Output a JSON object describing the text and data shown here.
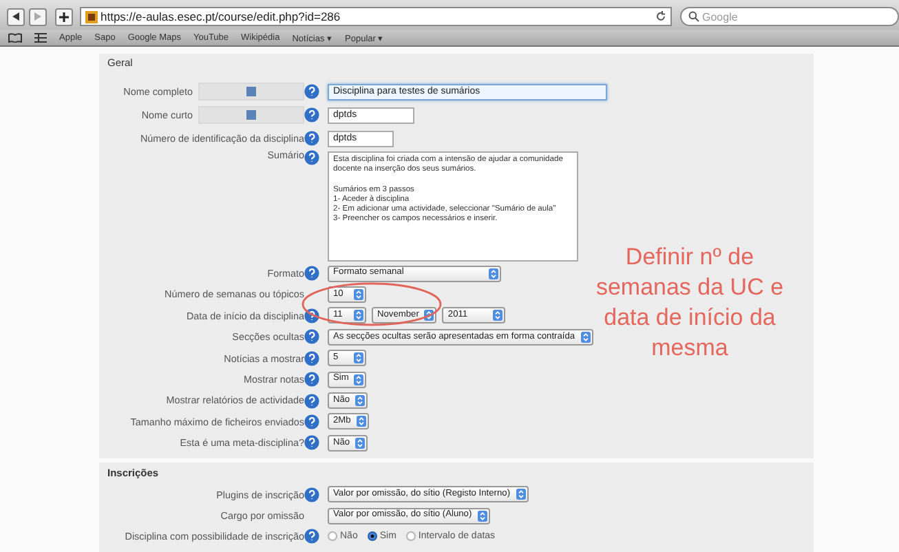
{
  "browser": {
    "url": "https://e-aulas.esec.pt/course/edit.php?id=286",
    "search_placeholder": "Google",
    "bookmarks": [
      {
        "label": "Apple"
      },
      {
        "label": "Sapo"
      },
      {
        "label": "Google Maps"
      },
      {
        "label": "YouTube"
      },
      {
        "label": "Wikipédia"
      },
      {
        "label": "Notícias",
        "arrow": "▾"
      },
      {
        "label": "Popular",
        "arrow": "▾"
      }
    ]
  },
  "sections": [
    {
      "title": "Geral",
      "fields": [
        {
          "label": "Nome completo",
          "help": true,
          "locked": true,
          "kind": "text",
          "value": "Disciplina para testes de sumários",
          "focused": true
        },
        {
          "label": "Nome curto",
          "help": true,
          "locked": true,
          "kind": "text",
          "value": "dptds",
          "focused": false
        },
        {
          "label": "Número de identificação da disciplina",
          "help": true,
          "locked": false,
          "kind": "text",
          "value": "dptds",
          "focused": false
        },
        {
          "label": "Sumário",
          "help": true,
          "locked": false,
          "kind": "textarea",
          "value": "Esta disciplina foi criada com a intensão de ajudar a comunidade docente na inserção dos seus sumários.\n\nSumários em 3 passos\n1- Aceder à disciplina\n2- Em adicionar uma actividade, seleccionar \"Sumário de aula\"\n3- Preencher os campos necessários e inserir."
        },
        {
          "label": "Formato",
          "help": true,
          "locked": false,
          "kind": "select",
          "values": [
            "Formato semanal"
          ],
          "wide": true
        },
        {
          "label": "Número de semanas ou tópicos",
          "help": false,
          "locked": false,
          "kind": "select",
          "values": [
            "10"
          ],
          "wide": false
        },
        {
          "label": "Data de início da disciplina",
          "help": true,
          "locked": false,
          "kind": "select",
          "values": [
            "11",
            "November",
            "2011"
          ],
          "wide": false
        },
        {
          "label": "Secções ocultas",
          "help": true,
          "locked": false,
          "kind": "select",
          "values": [
            "As secções ocultas serão apresentadas em forma contraída"
          ],
          "wide": false
        },
        {
          "label": "Notícias a mostrar",
          "help": true,
          "locked": false,
          "kind": "select",
          "values": [
            "5"
          ],
          "wide": false
        },
        {
          "label": "Mostrar notas",
          "help": true,
          "locked": false,
          "kind": "select",
          "values": [
            "Sim"
          ],
          "wide": false
        },
        {
          "label": "Mostrar relatórios de actividade",
          "help": true,
          "locked": false,
          "kind": "select",
          "values": [
            "Não"
          ],
          "wide": false
        },
        {
          "label": "Tamanho máximo de ficheiros enviados",
          "help": true,
          "locked": false,
          "kind": "select",
          "values": [
            "2Mb"
          ],
          "wide": false
        },
        {
          "label": "Esta é uma meta-disciplina?",
          "help": true,
          "locked": false,
          "kind": "select",
          "values": [
            "Não"
          ],
          "wide": false
        }
      ]
    },
    {
      "title": "Inscrições",
      "fields": [
        {
          "label": "Plugins de inscrição",
          "help": true,
          "locked": false,
          "kind": "select",
          "values": [
            "Valor por omissão, do sítio (Registo Interno)"
          ],
          "wide": false
        },
        {
          "label": "Cargo por omissão",
          "help": false,
          "locked": false,
          "kind": "select",
          "values": [
            "Valor por omissão, do sítio (Aluno)"
          ],
          "wide": false
        },
        {
          "label": "Disciplina com possibilidade de inscrição",
          "help": true,
          "locked": false,
          "kind": "radio",
          "options": [
            {
              "label": "Não",
              "selected": false
            },
            {
              "label": "Sim",
              "selected": true
            },
            {
              "label": "Intervalo de datas",
              "selected": false
            }
          ]
        }
      ]
    }
  ],
  "annotation": {
    "text": "Definir nº de semanas da UC e data de início da mesma"
  }
}
